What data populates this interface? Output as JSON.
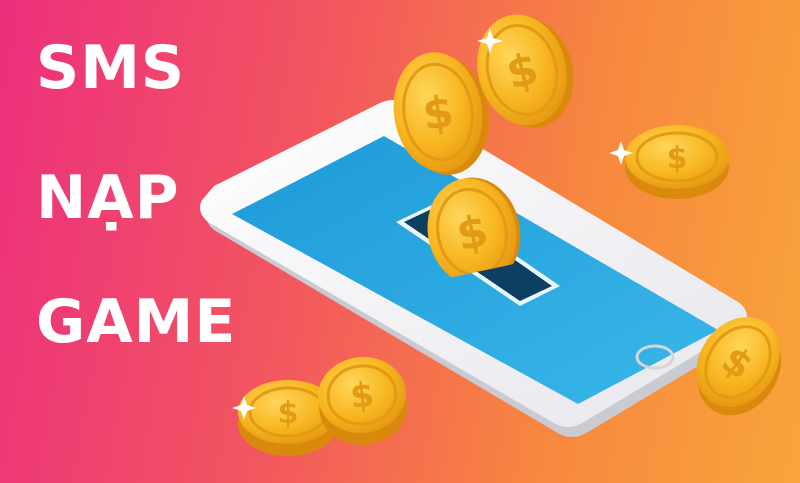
{
  "banner": {
    "lines": [
      "SMS",
      "NẠP",
      "GAME"
    ],
    "currency_symbol": "$",
    "colors": {
      "background_left": "#ec2f7d",
      "background_right": "#f9a43a",
      "phone_body": "#f4f4f6",
      "screen": "#2aa7df",
      "coin": "#f5b21c",
      "coin_edge": "#d98a0c",
      "text": "#ffffff"
    },
    "icons": [
      "smartphone-icon",
      "coin-icon",
      "sparkle-icon"
    ]
  }
}
